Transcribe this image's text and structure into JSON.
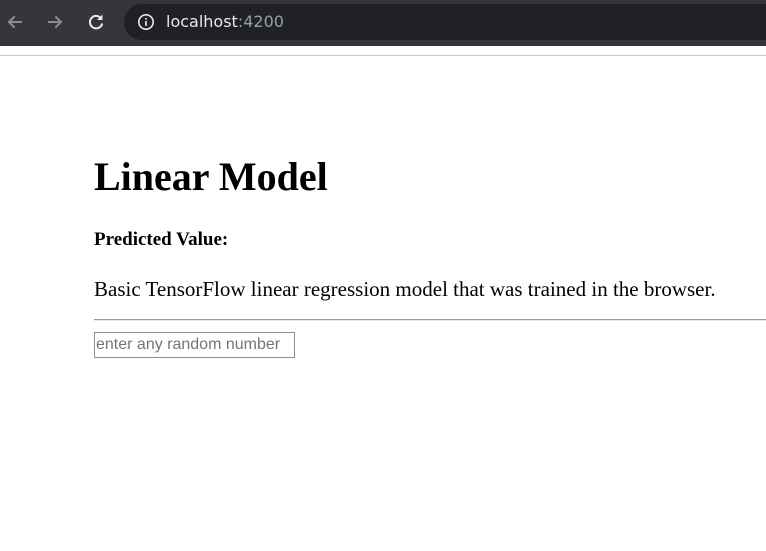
{
  "browser": {
    "url_host": "localhost",
    "url_port": ":4200",
    "back_icon": "arrow-left-icon",
    "forward_icon": "arrow-right-icon",
    "reload_icon": "reload-icon",
    "info_icon": "info-icon"
  },
  "page": {
    "title": "Linear Model",
    "predicted_label": "Predicted Value:",
    "description": "Basic TensorFlow linear regression model that was trained in the browser.",
    "input": {
      "value": "",
      "placeholder": "enter any random number"
    }
  },
  "colors": {
    "browser_bar": "#35363a",
    "omnibox": "#202124",
    "url_text": "#e8eaed",
    "url_port": "#9aa0a6"
  }
}
